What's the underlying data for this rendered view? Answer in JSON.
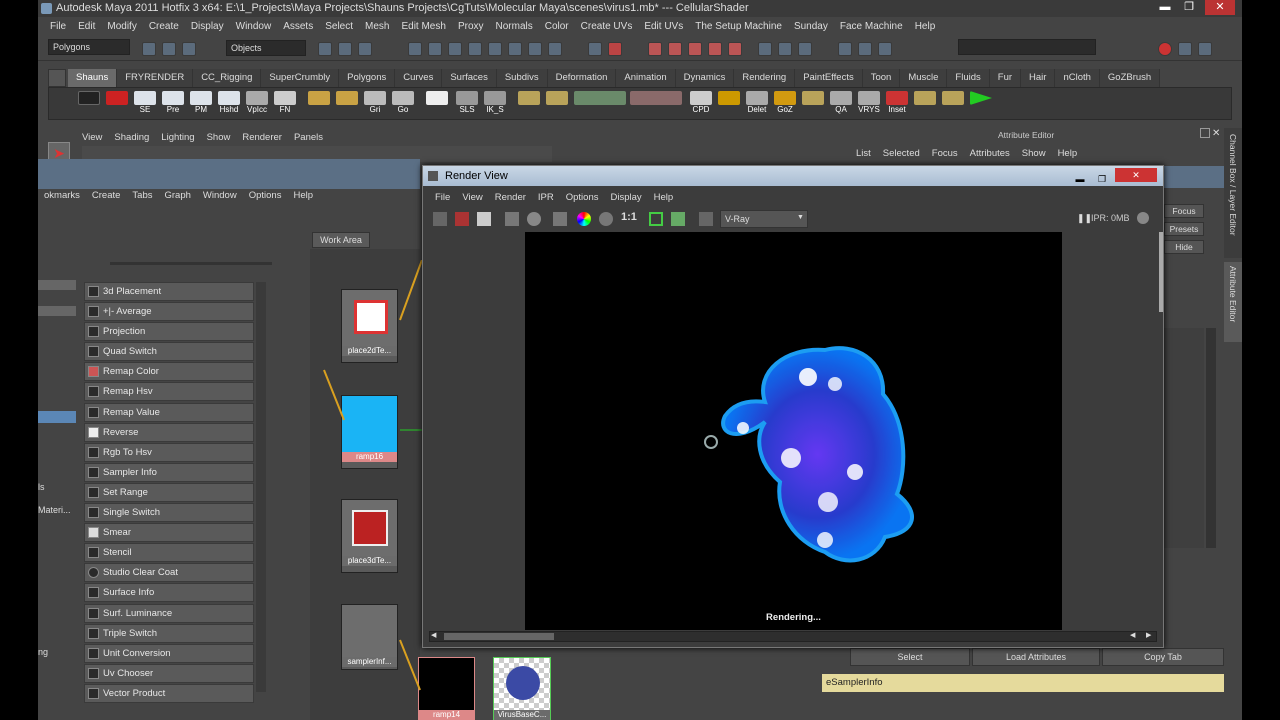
{
  "window": {
    "title": "Autodesk Maya 2011 Hotfix 3 x64: E:\\1_Projects\\Maya Projects\\Shauns Projects\\CgTuts\\Molecular Maya\\scenes\\virus1.mb*  ---   CellularShader",
    "min": "▬",
    "max": "❐",
    "close": "✕"
  },
  "menubar": [
    "File",
    "Edit",
    "Modify",
    "Create",
    "Display",
    "Window",
    "Assets",
    "Select",
    "Mesh",
    "Edit Mesh",
    "Proxy",
    "Normals",
    "Color",
    "Create UVs",
    "Edit UVs",
    "The Setup Machine",
    "Sunday",
    "Face Machine",
    "Help"
  ],
  "statusline": {
    "mode": "Polygons",
    "objects": "Objects"
  },
  "shelf_tabs": [
    "Shauns",
    "FRYRENDER",
    "CC_Rigging",
    "SuperCrumbly",
    "Polygons",
    "Curves",
    "Surfaces",
    "Subdivs",
    "Deformation",
    "Animation",
    "Dynamics",
    "Rendering",
    "PaintEffects",
    "Toon",
    "Muscle",
    "Fluids",
    "Fur",
    "Hair",
    "nCloth",
    "GoZBrush"
  ],
  "shelf_buttons": [
    "",
    "",
    "SE",
    "Pre",
    "PM",
    "Hshd",
    "VpIcc",
    "FN",
    "",
    "",
    "Gri",
    "Go",
    "",
    "SLS",
    "IK_S",
    "",
    "",
    "",
    "",
    "CPD",
    "",
    "Delet",
    "GoZ",
    "",
    "QA",
    "VRYS",
    "Inset",
    "",
    "",
    ""
  ],
  "panel_menu": [
    "View",
    "Shading",
    "Lighting",
    "Show",
    "Renderer",
    "Panels"
  ],
  "hypershade": {
    "menu": [
      "okmarks",
      "Create",
      "Tabs",
      "Graph",
      "Window",
      "Options",
      "Help"
    ],
    "work_area_tab": "Work Area",
    "nodes": [
      "3d Placement",
      "+|- Average",
      "Projection",
      "Quad Switch",
      "Remap Color",
      "Remap Hsv",
      "Remap Value",
      "Reverse",
      "Rgb To Hsv",
      "Sampler Info",
      "Set Range",
      "Single Switch",
      "Smear",
      "Stencil",
      "Studio Clear Coat",
      "Surface Info",
      "Surf. Luminance",
      "Triple Switch",
      "Unit Conversion",
      "Uv Chooser",
      "Vector Product"
    ],
    "side_labels": [
      "ls",
      "Materi...",
      "ng"
    ],
    "swatches": [
      "place2dTe...",
      "ramp16",
      "place3dTe...",
      "samplerInf...",
      "ramp14",
      "VirusBaseC..."
    ]
  },
  "render_view": {
    "title": "Render View",
    "menu": [
      "File",
      "View",
      "Render",
      "IPR",
      "Options",
      "Display",
      "Help"
    ],
    "one_to_one": "1:1",
    "renderer": "V-Ray",
    "ipr_status": "IPR: 0MB",
    "status": "Rendering..."
  },
  "attribute_editor": {
    "title": "Attribute Editor",
    "menu": [
      "List",
      "Selected",
      "Focus",
      "Attributes",
      "Show",
      "Help"
    ],
    "side_buttons": [
      "Focus",
      "Presets",
      "Hide"
    ],
    "bottom_buttons": [
      "Select",
      "Load Attributes",
      "Copy Tab"
    ],
    "node_field": "eSamplerInfo",
    "side_tabs": [
      "Channel Box / Layer Editor",
      "Attribute Editor"
    ]
  }
}
